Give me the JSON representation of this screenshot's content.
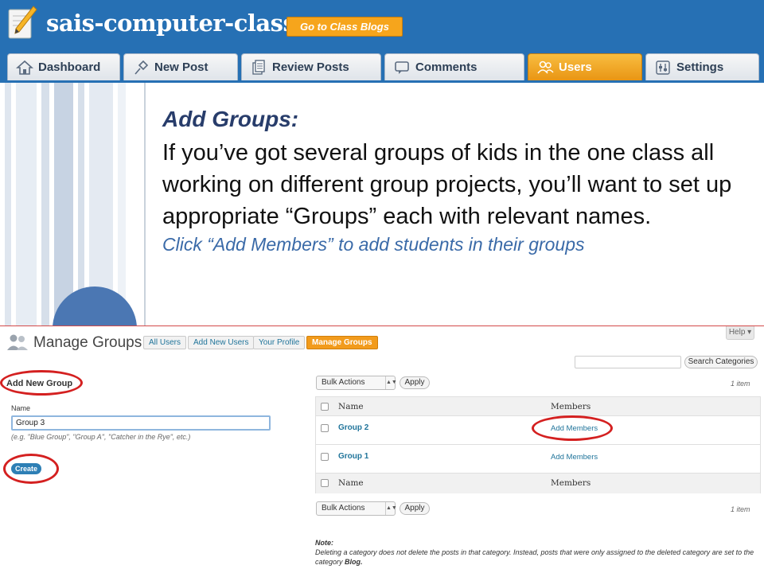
{
  "header": {
    "site_title": "sais-computer-class",
    "blogs_button": "Go to Class Blogs",
    "bg_color": "#2670b4",
    "logo_icon": "pencil-page-icon"
  },
  "tabs": [
    {
      "label": "Dashboard",
      "icon": "house-icon"
    },
    {
      "label": "New Post",
      "icon": "pushpin-icon"
    },
    {
      "label": "Review Posts",
      "icon": "documents-icon"
    },
    {
      "label": "Comments",
      "icon": "speech-bubble-icon"
    },
    {
      "label": "Users",
      "icon": "users-icon",
      "active": true
    },
    {
      "label": "Settings",
      "icon": "sliders-icon"
    }
  ],
  "slide": {
    "heading": "Add Groups:",
    "body": "If you’ve got several groups of kids in the one class all working on different group projects, you’ll want to set up appropriate “Groups” each with relevant names.",
    "instruction": "Click “Add Members” to add students in their groups",
    "accent_color": "#4b77b3"
  },
  "manage": {
    "title": "Manage Groups",
    "nav_buttons": [
      "All Users",
      "Add New Users",
      "Your Profile",
      "Manage Groups"
    ],
    "help": "Help ▾",
    "add_new_heading": "Add New Group",
    "name_label": "Name",
    "name_value": "Group 3",
    "hint": "(e.g. \"Blue Group\", \"Group A\", \"Catcher in the Rye\", etc.)",
    "create_button": "Create",
    "search_button": "Search Categories",
    "bulk_actions": "Bulk Actions",
    "apply": "Apply",
    "count": "1 item",
    "columns": [
      "Name",
      "Members"
    ],
    "rows": [
      {
        "name": "Group 2",
        "members": "Add Members"
      },
      {
        "name": "Group 1",
        "members": "Add Members"
      }
    ],
    "note_label": "Note:",
    "note_text": "Deleting a category does not delete the posts in that category. Instead, posts that were only assigned to the deleted category are set to the category",
    "note_blog": "Blog."
  },
  "highlight_color": "#d42020"
}
